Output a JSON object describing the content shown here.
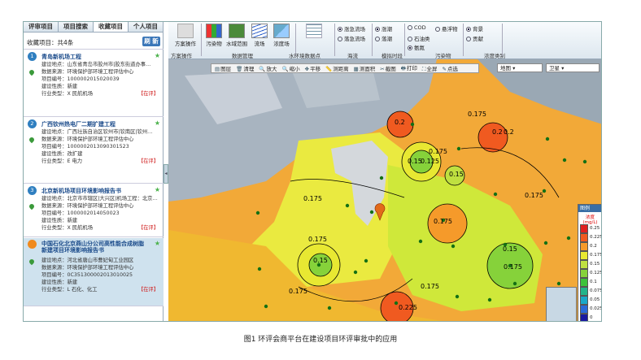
{
  "tabs": [
    "评审项目",
    "项目搜索",
    "收藏项目",
    "个人项目"
  ],
  "left": {
    "count_label": "收藏项目：共4条",
    "refresh": "刷 新",
    "items": [
      {
        "num": "1",
        "title": "青岛新机场工程",
        "lines": [
          "建设地点：山东省青岛市胶州市|胶东街道办事…",
          "数据来源：环境保护部环境工程评估中心",
          "项目编号：100000201502003​9",
          "建设性质：新建",
          "行业类型：Ⅹ 民航机场"
        ],
        "detail": "【在评】"
      },
      {
        "num": "2",
        "title": "广西钦州热电厂二期扩建工程",
        "lines": [
          "建设地点：广西壮族自治区钦州市|钦南区|钦州…",
          "数据来源：环境保护部环境工程评估中心",
          "项目编号：1000002013090301523",
          "建设性质：改扩建",
          "行业类型：E 电力"
        ],
        "detail": "【在评】"
      },
      {
        "num": "3",
        "title": "北京新机场项目环境影响报告书",
        "lines": [
          "建设地点：北京市市辖区|大兴区|机场工程：北京…",
          "数据来源：环境保护部环境工程评估中心",
          "项目编号：100000201405​0023",
          "建设性质：新建",
          "行业类型：Ⅹ 民航机场"
        ],
        "detail": "【在评】"
      },
      {
        "num": "",
        "title": "中国石化北京燕山分公司高性能合成树脂新建项目环境影响报告书",
        "lines": [
          "建设地点：河北省唐山市曹妃甸工业园区",
          "数据来源：环境保护部环境工程评估中心",
          "项目编号：0C351300002013010025",
          "建设性质：新建",
          "行业类型：L 石化、化工"
        ],
        "detail": "【在评】"
      }
    ]
  },
  "ribbon": {
    "buttons": [
      {
        "label": "方案操作"
      },
      {
        "label": "污染物"
      },
      {
        "label": "水域范围"
      },
      {
        "label": "流场"
      },
      {
        "label": "浓度场"
      },
      {
        "label": ""
      }
    ],
    "groups": [
      "方案操作",
      "数据管理",
      "水环境数据点",
      "海流",
      "模拟时段",
      "污染物",
      "浓度类别"
    ],
    "sea_options": [
      "涨急流场",
      "落急流场",
      "涨潮",
      "落潮"
    ],
    "pollutant_options": [
      "COD",
      "悬浮物",
      "石油类",
      "氨氮"
    ],
    "conc_options": [
      "背景",
      "贡献"
    ]
  },
  "toolbar": [
    "图层",
    "清理",
    "放大",
    "缩小",
    "平移",
    "测距离",
    "测面积",
    "截图",
    "打印",
    "全屏",
    "点选"
  ],
  "map_select": "地图",
  "layer_select": "卫星",
  "legend": {
    "header": "图例",
    "title": "浓度(mg/L)",
    "values": [
      "0.25",
      "0.225",
      "0.2",
      "0.175",
      "0.15",
      "0.125",
      "0.1",
      "0.075",
      "0.05",
      "0.025",
      "0"
    ],
    "colors": [
      "#e02020",
      "#f05a20",
      "#f59a2a",
      "#e8e832",
      "#bfe040",
      "#86d23a",
      "#3cc23a",
      "#22b48a",
      "#1aa8c8",
      "#2a6ad8",
      "#1a1aa0"
    ]
  },
  "contours": [
    {
      "label": "0.2"
    },
    {
      "label": "0.175"
    },
    {
      "label": "0.15"
    },
    {
      "label": "0.125"
    },
    {
      "label": "0.15"
    },
    {
      "label": "0.175"
    },
    {
      "label": "0.175"
    },
    {
      "label": "0.175"
    },
    {
      "label": "0.175"
    },
    {
      "label": "0.15"
    },
    {
      "label": "0.175"
    },
    {
      "label": "0.15"
    },
    {
      "label": "0.175"
    },
    {
      "label": "0.175"
    },
    {
      "label": "0.225"
    },
    {
      "label": "0.2"
    },
    {
      "label": "0.2"
    },
    {
      "label": "0.175"
    }
  ],
  "caption": "图1 环评会商平台在建设项目环评审批中的应用"
}
